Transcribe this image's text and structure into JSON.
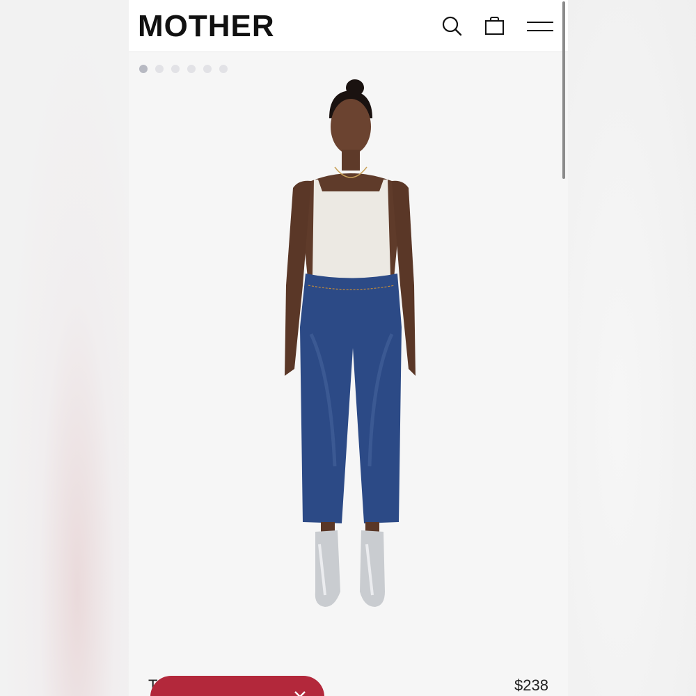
{
  "header": {
    "logo": "MOTHER",
    "icons": [
      "search-icon",
      "shopping-bag-icon",
      "menu-icon"
    ]
  },
  "gallery": {
    "image_count": 6,
    "active_index": 0
  },
  "product": {
    "title": "T",
    "price": "$238"
  },
  "colors": {
    "promo_accent": "#b3283b",
    "denim": "#2c4a86"
  }
}
